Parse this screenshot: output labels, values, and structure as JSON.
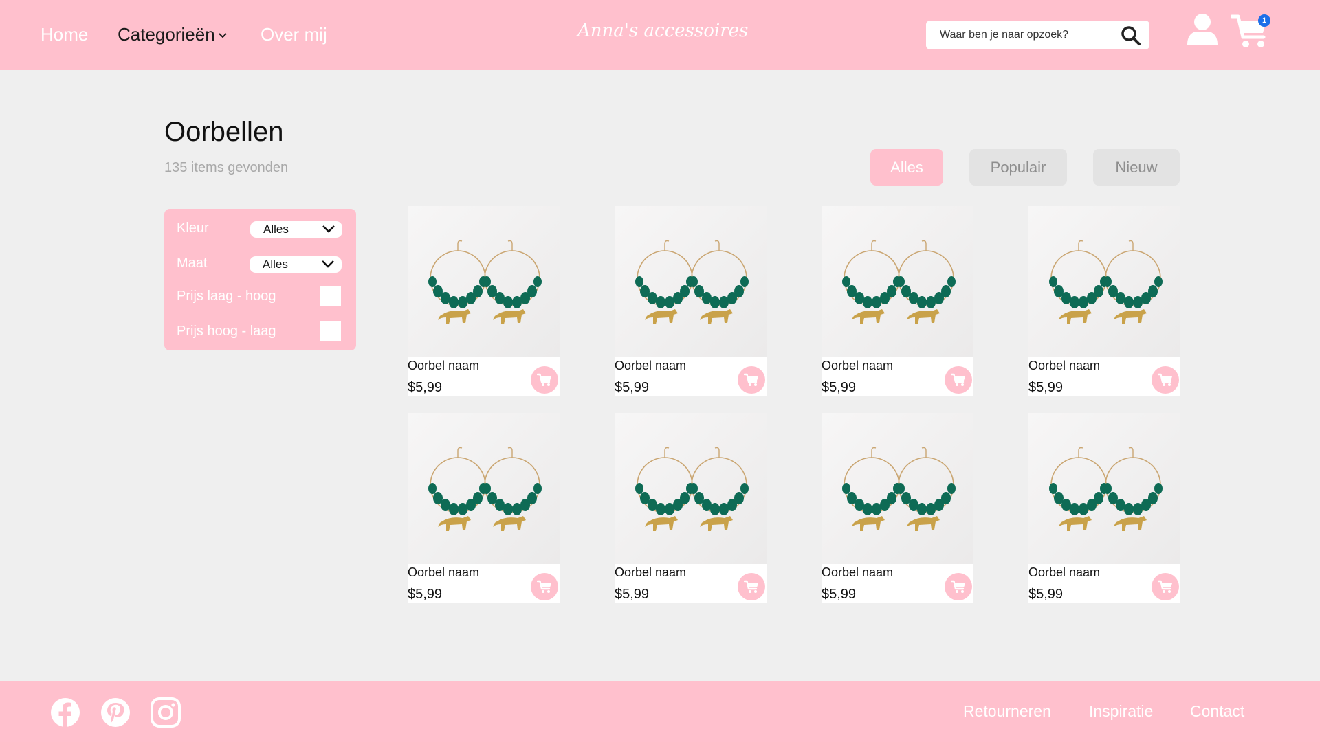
{
  "header": {
    "nav": [
      {
        "label": "Home"
      },
      {
        "label": "Categorieën"
      },
      {
        "label": "Over mij"
      }
    ],
    "logo": "Anna's accessoires",
    "search_placeholder": "Waar ben je naar opzoek?",
    "cart_count": "1"
  },
  "page": {
    "title": "Oorbellen",
    "item_count": "135 items gevonden"
  },
  "tabs": [
    {
      "label": "Alles",
      "active": true
    },
    {
      "label": "Populair",
      "active": false
    },
    {
      "label": "Nieuw",
      "active": false
    }
  ],
  "filter": {
    "color_label": "Kleur",
    "color_value": "Alles",
    "size_label": "Maat",
    "size_value": "Alles",
    "price_low_high": "Prijs laag - hoog",
    "price_high_low": "Prijs hoog - laag"
  },
  "products": [
    {
      "name": "Oorbel naam",
      "price": "$5,99"
    },
    {
      "name": "Oorbel naam",
      "price": "$5,99"
    },
    {
      "name": "Oorbel naam",
      "price": "$5,99"
    },
    {
      "name": "Oorbel naam",
      "price": "$5,99"
    },
    {
      "name": "Oorbel naam",
      "price": "$5,99"
    },
    {
      "name": "Oorbel naam",
      "price": "$5,99"
    },
    {
      "name": "Oorbel naam",
      "price": "$5,99"
    },
    {
      "name": "Oorbel naam",
      "price": "$5,99"
    }
  ],
  "footer": {
    "social_icons": [
      "facebook-icon",
      "pinterest-icon",
      "instagram-icon"
    ],
    "links": [
      "Retourneren",
      "Inspiratie",
      "Contact"
    ]
  },
  "colors": {
    "brand_pink": "#ffc0cd",
    "background": "#efefef",
    "badge_blue": "#1d6fe8"
  }
}
